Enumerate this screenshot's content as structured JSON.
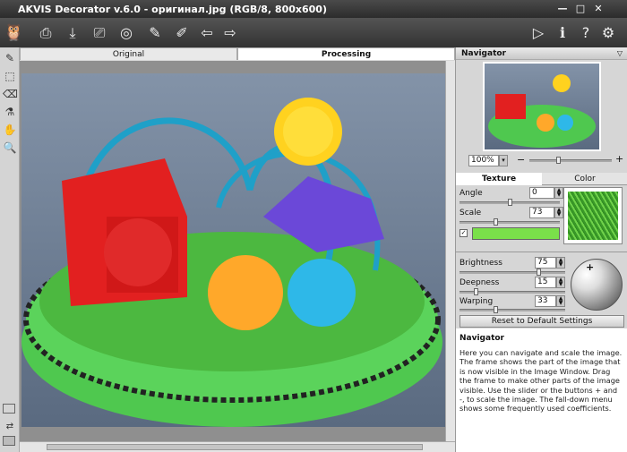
{
  "window": {
    "title": "AKVIS Decorator v.6.0 - оригинал.jpg (RGB/8, 800x600)"
  },
  "tabs": [
    {
      "label": "Original"
    },
    {
      "label": "Processing"
    }
  ],
  "navigator": {
    "title": "Navigator",
    "zoom": "100%"
  },
  "panel_tabs": [
    {
      "label": "Texture"
    },
    {
      "label": "Color"
    }
  ],
  "texture": {
    "angle_label": "Angle",
    "angle_value": "0",
    "scale_label": "Scale",
    "scale_value": "73",
    "color_swatch": "#7ae04a"
  },
  "lighting": {
    "brightness_label": "Brightness",
    "brightness_value": "75",
    "deepness_label": "Deepness",
    "deepness_value": "15",
    "warping_label": "Warping",
    "warping_value": "33",
    "reset_label": "Reset to Default Settings"
  },
  "help": {
    "title": "Navigator",
    "text": "Here you can navigate and scale the image. The frame shows the part of the image that is now visible in the Image Window. Drag the frame to make other parts of the image visible. Use the slider or the buttons + and -, to scale the image. The fall-down menu shows some frequently used coefficients."
  },
  "icons": [
    "logo-icon",
    "open-icon",
    "save-icon",
    "print-icon",
    "share-icon",
    "load-preset-icon",
    "save-preset-icon",
    "back-icon",
    "forward-icon",
    "run-icon",
    "info-icon",
    "help-icon",
    "settings-icon"
  ]
}
